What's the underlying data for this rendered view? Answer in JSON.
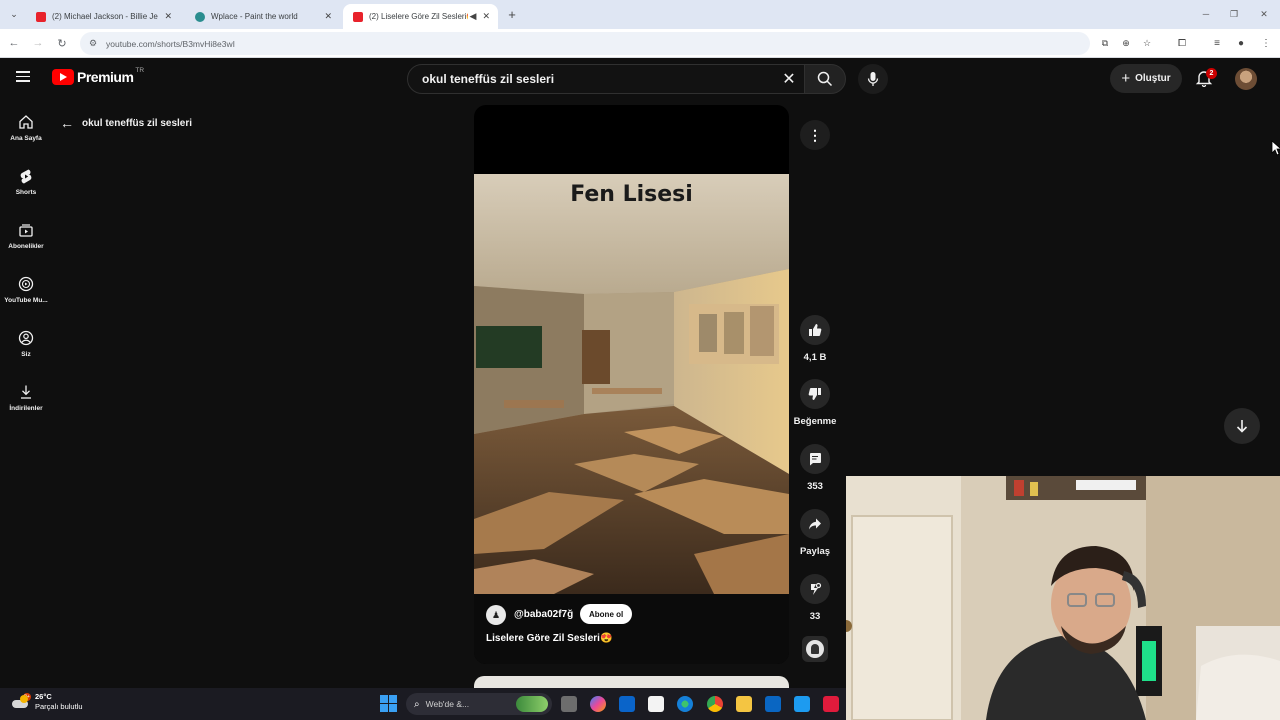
{
  "browser": {
    "tabs": [
      {
        "title": "(2) Michael Jackson - Billie Jean",
        "favicon_color": "#e8222b",
        "active": false
      },
      {
        "title": "Wplace - Paint the world",
        "favicon_color": "#2a8d8f",
        "active": false
      },
      {
        "title": "(2) Liselere Göre Zil Sesleri😍",
        "favicon_color": "#e8222b",
        "active": true
      }
    ],
    "url": "youtube.com/shorts/B3mvHi8e3wI"
  },
  "youtube": {
    "logo_text": "Premium",
    "country_code": "TR",
    "search_value": "okul teneffüs zil sesleri",
    "create_label": "Oluştur",
    "notification_count": "2",
    "sidebar": [
      {
        "label": "Ana Sayfa",
        "icon": "home-icon"
      },
      {
        "label": "Shorts",
        "icon": "shorts-icon"
      },
      {
        "label": "Abonelikler",
        "icon": "subscriptions-icon"
      },
      {
        "label": "YouTube Mu...",
        "icon": "youtube-music-icon"
      },
      {
        "label": "Siz",
        "icon": "you-icon"
      },
      {
        "label": "İndirilenler",
        "icon": "downloads-icon"
      }
    ],
    "back_query": "okul teneffüs zil sesleri"
  },
  "short": {
    "overlay_title": "Fen Lisesi",
    "channel": "@baba02f7ğ",
    "subscribe_label": "Abone ol",
    "title": "Liselere Göre Zil Sesleri😍",
    "likes": "4,1 B",
    "dislike_label": "Beğenme",
    "comments": "353",
    "share_label": "Paylaş",
    "remix_count": "33"
  },
  "taskbar": {
    "temperature": "26°C",
    "weather_desc": "Parçalı bulutlu",
    "weather_badge": "9+",
    "search_placeholder": "Web'de &..."
  },
  "colors": {
    "yt_red": "#ff0000",
    "bg": "#0f0f0f"
  }
}
